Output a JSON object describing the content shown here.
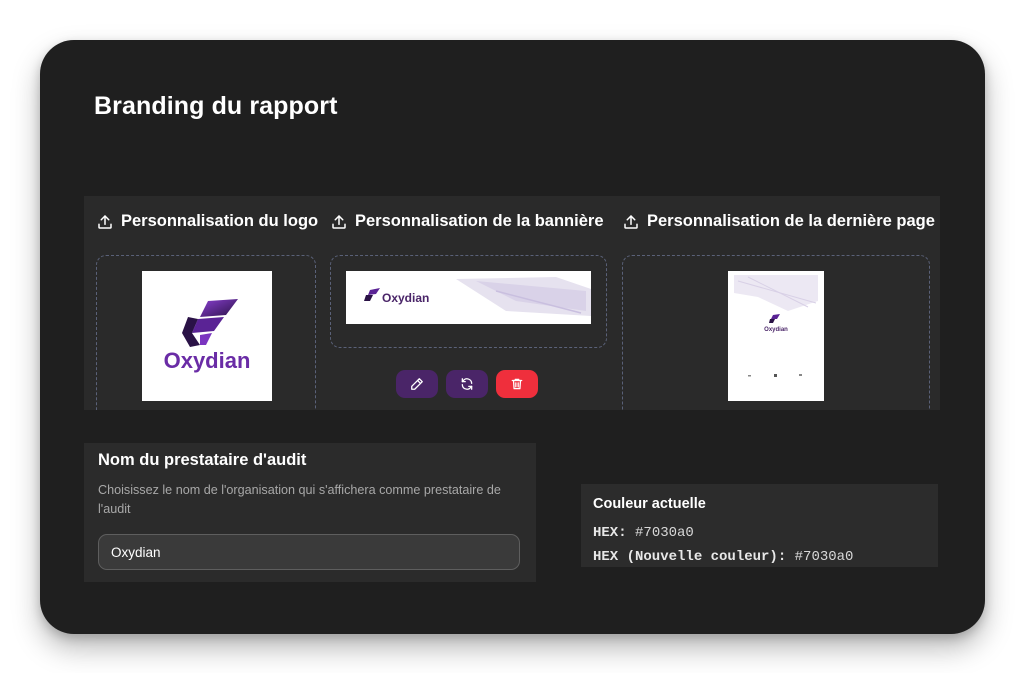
{
  "page": {
    "title": "Branding du rapport"
  },
  "uploads": {
    "logo": {
      "label": "Personnalisation du logo",
      "brand": "Oxydian"
    },
    "banner": {
      "label": "Personnalisation de la bannière",
      "brand": "Oxydian"
    },
    "last_page": {
      "label": "Personnalisation de la dernière page",
      "brand": "Oxydian"
    }
  },
  "banner_actions": {
    "edit_icon": "pencil-icon",
    "replace_icon": "refresh-icon",
    "delete_icon": "trash-icon"
  },
  "provider": {
    "title": "Nom du prestataire d'audit",
    "description": "Choisissez le nom de l'organisation qui s'affichera comme prestataire de l'audit",
    "value": "Oxydian"
  },
  "color": {
    "title": "Couleur actuelle",
    "hex_label": "HEX:",
    "hex_value": "#7030a0",
    "new_hex_label": "HEX (Nouvelle couleur):",
    "new_hex_value": "#7030a0"
  },
  "colors": {
    "brand": "#7030a0",
    "button_purple": "#4a2568",
    "button_red": "#ef2f3c",
    "panel_bg": "#1f1f1f"
  }
}
